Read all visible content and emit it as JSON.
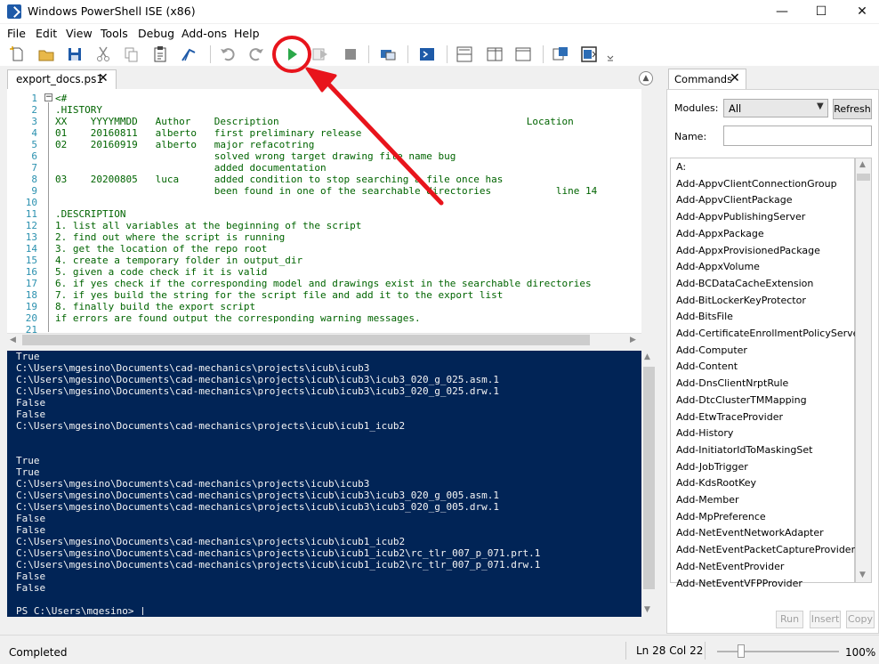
{
  "window": {
    "title": "Windows PowerShell ISE (x86)",
    "minimize_glyph": "—",
    "maximize_glyph": "☐",
    "close_glyph": "✕"
  },
  "menu": [
    "File",
    "Edit",
    "View",
    "Tools",
    "Debug",
    "Add-ons",
    "Help"
  ],
  "toolbar_icons": [
    "new-script-icon",
    "open-folder-icon",
    "save-icon",
    "cut-icon",
    "copy-icon",
    "paste-icon",
    "clear-console-icon",
    "undo-icon",
    "redo-icon",
    "run-script-icon",
    "run-selection-icon",
    "stop-icon",
    "remote-powershell-tab-icon",
    "start-powershell-icon",
    "show-script-top-icon",
    "show-script-right-icon",
    "show-script-maximized-icon",
    "show-commands-icon",
    "show-addon-icon",
    "toolbar-overflow-icon"
  ],
  "editor": {
    "tab_label": "export_docs.ps1",
    "tab_close": "✕",
    "fold_glyph": "−",
    "line_numbers": [
      "1",
      "2",
      "3",
      "4",
      "5",
      "6",
      "7",
      "8",
      "9",
      "10",
      "11",
      "12",
      "13",
      "14",
      "15",
      "16",
      "17",
      "18",
      "19",
      "20",
      "21"
    ],
    "code_lines": [
      "<#",
      ".HISTORY",
      "XX    YYYYMMDD   Author    Description                                          Location",
      "01    20160811   alberto   first preliminary release",
      "02    20160919   alberto   major refacotring",
      "                           solved wrong target drawing file name bug",
      "                           added documentation",
      "03    20200805   luca      added condition to stop searching a file once has",
      "                           been found in one of the searchable directories           line 14",
      "",
      ".DESCRIPTION",
      "1. list all variables at the beginning of the script",
      "2. find out where the script is running",
      "3. get the location of the repo root",
      "4. create a temporary folder in output_dir",
      "5. given a code check if it is valid",
      "6. if yes check if the corresponding model and drawings exist in the searchable directories",
      "7. if yes build the string for the script file and add it to the export list",
      "8. finally build the export script",
      "if errors are found output the corresponding warning messages.",
      ""
    ]
  },
  "console": {
    "lines": [
      "True",
      "C:\\Users\\mgesino\\Documents\\cad-mechanics\\projects\\icub\\icub3",
      "C:\\Users\\mgesino\\Documents\\cad-mechanics\\projects\\icub\\icub3\\icub3_020_g_025.asm.1",
      "C:\\Users\\mgesino\\Documents\\cad-mechanics\\projects\\icub\\icub3\\icub3_020_g_025.drw.1",
      "False",
      "False",
      "C:\\Users\\mgesino\\Documents\\cad-mechanics\\projects\\icub\\icub1_icub2",
      "",
      "",
      "True",
      "True",
      "C:\\Users\\mgesino\\Documents\\cad-mechanics\\projects\\icub\\icub3",
      "C:\\Users\\mgesino\\Documents\\cad-mechanics\\projects\\icub\\icub3\\icub3_020_g_005.asm.1",
      "C:\\Users\\mgesino\\Documents\\cad-mechanics\\projects\\icub\\icub3\\icub3_020_g_005.drw.1",
      "False",
      "False",
      "C:\\Users\\mgesino\\Documents\\cad-mechanics\\projects\\icub\\icub1_icub2",
      "C:\\Users\\mgesino\\Documents\\cad-mechanics\\projects\\icub\\icub1_icub2\\rc_tlr_007_p_071.prt.1",
      "C:\\Users\\mgesino\\Documents\\cad-mechanics\\projects\\icub\\icub1_icub2\\rc_tlr_007_p_071.drw.1",
      "False",
      "False",
      "",
      "PS C:\\Users\\mgesino> |"
    ]
  },
  "commands": {
    "tab_label": "Commands",
    "tab_close": "✕",
    "modules_label": "Modules:",
    "modules_value": "All",
    "refresh_label": "Refresh",
    "name_label": "Name:",
    "items": [
      "A:",
      "Add-AppvClientConnectionGroup",
      "Add-AppvClientPackage",
      "Add-AppvPublishingServer",
      "Add-AppxPackage",
      "Add-AppxProvisionedPackage",
      "Add-AppxVolume",
      "Add-BCDataCacheExtension",
      "Add-BitLockerKeyProtector",
      "Add-BitsFile",
      "Add-CertificateEnrollmentPolicyServer",
      "Add-Computer",
      "Add-Content",
      "Add-DnsClientNrptRule",
      "Add-DtcClusterTMMapping",
      "Add-EtwTraceProvider",
      "Add-History",
      "Add-InitiatorIdToMaskingSet",
      "Add-JobTrigger",
      "Add-KdsRootKey",
      "Add-Member",
      "Add-MpPreference",
      "Add-NetEventNetworkAdapter",
      "Add-NetEventPacketCaptureProvider",
      "Add-NetEventProvider",
      "Add-NetEventVFPProvider"
    ],
    "run_label": "Run",
    "insert_label": "Insert",
    "copy_label": "Copy"
  },
  "status": {
    "text": "Completed",
    "line_label": "Ln 28",
    "col_label": "Col 22",
    "zoom": "100%",
    "zoom_level": 1.0
  },
  "colors": {
    "console_bg": "#012456",
    "comment_green": "#006400",
    "line_number": "#2b91af",
    "annotation_red": "#e8141c"
  }
}
